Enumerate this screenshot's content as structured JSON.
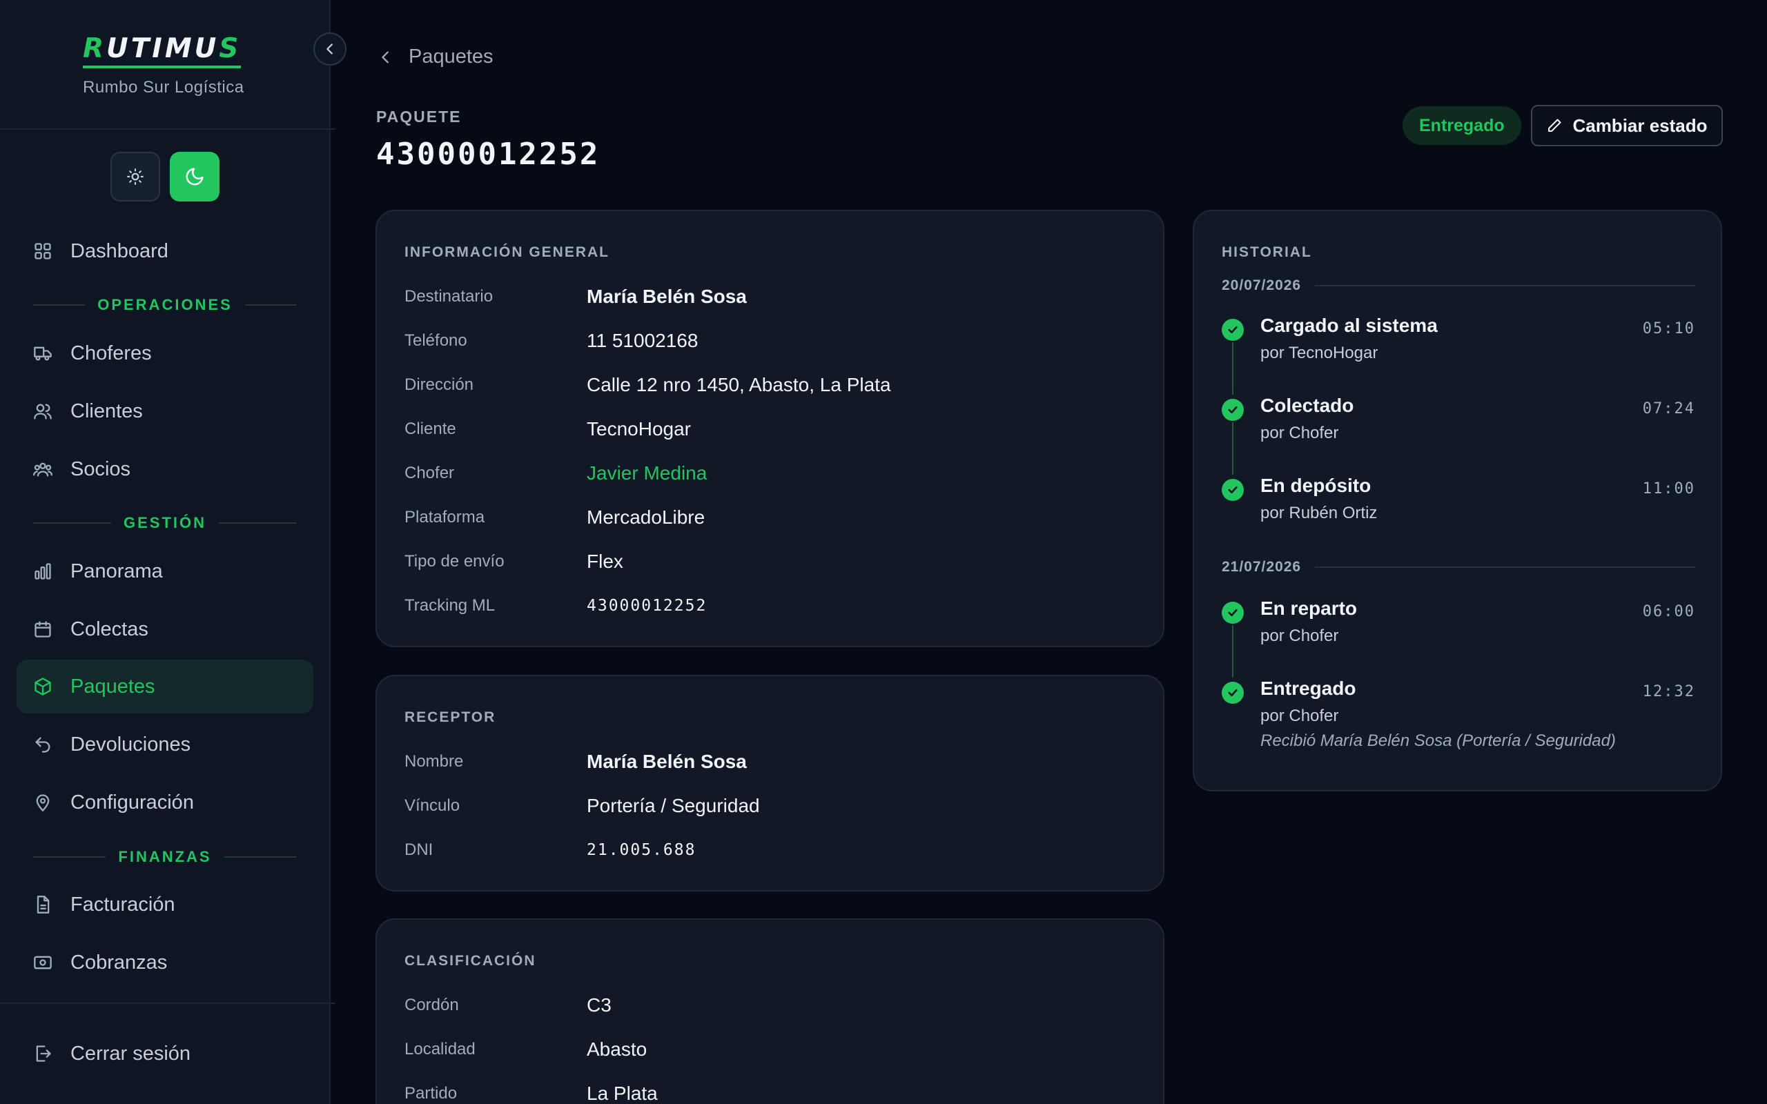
{
  "brand": {
    "logo_first": "R",
    "logo_middle": "UTIMU",
    "logo_last": "S",
    "subtitle": "Rumbo Sur Logística"
  },
  "sidebar": {
    "dashboard": "Dashboard",
    "sections": {
      "operaciones": "OPERACIONES",
      "gestion": "GESTIÓN",
      "finanzas": "FINANZAS"
    },
    "items": {
      "choferes": "Choferes",
      "clientes": "Clientes",
      "socios": "Socios",
      "panorama": "Panorama",
      "colectas": "Colectas",
      "paquetes": "Paquetes",
      "devoluciones": "Devoluciones",
      "configuracion": "Configuración",
      "facturacion": "Facturación",
      "cobranzas": "Cobranzas"
    },
    "logout": "Cerrar sesión",
    "active_item": "paquetes"
  },
  "header": {
    "back_label": "Paquetes",
    "label": "PAQUETE",
    "package_id": "43000012252",
    "status": "Entregado",
    "change_status": "Cambiar estado"
  },
  "general": {
    "title": "INFORMACIÓN GENERAL",
    "rows": [
      {
        "label": "Destinatario",
        "value": "María Belén Sosa"
      },
      {
        "label": "Teléfono",
        "value": "11 51002168"
      },
      {
        "label": "Dirección",
        "value": "Calle 12 nro 1450, Abasto, La Plata"
      },
      {
        "label": "Cliente",
        "value": "TecnoHogar"
      },
      {
        "label": "Chofer",
        "value": "Javier Medina"
      },
      {
        "label": "Plataforma",
        "value": "MercadoLibre"
      },
      {
        "label": "Tipo de envío",
        "value": "Flex"
      },
      {
        "label": "Tracking ML",
        "value": "43000012252"
      }
    ]
  },
  "receptor": {
    "title": "RECEPTOR",
    "rows": [
      {
        "label": "Nombre",
        "value": "María Belén Sosa"
      },
      {
        "label": "Vínculo",
        "value": "Portería / Seguridad"
      },
      {
        "label": "DNI",
        "value": "21.005.688"
      }
    ]
  },
  "clasificacion": {
    "title": "CLASIFICACIÓN",
    "rows": [
      {
        "label": "Cordón",
        "value": "C3"
      },
      {
        "label": "Localidad",
        "value": "Abasto"
      },
      {
        "label": "Partido",
        "value": "La Plata"
      }
    ]
  },
  "historial": {
    "title": "HISTORIAL",
    "groups": [
      {
        "date": "20/07/2026",
        "events": [
          {
            "title": "Cargado al sistema",
            "by": "por TecnoHogar",
            "time": "05:10"
          },
          {
            "title": "Colectado",
            "by": "por Chofer",
            "time": "07:24"
          },
          {
            "title": "En depósito",
            "by": "por Rubén Ortiz",
            "time": "11:00"
          }
        ]
      },
      {
        "date": "21/07/2026",
        "events": [
          {
            "title": "En reparto",
            "by": "por Chofer",
            "time": "06:00"
          },
          {
            "title": "Entregado",
            "by": "por Chofer",
            "time": "12:32",
            "note": "Recibió María Belén Sosa (Portería / Seguridad)"
          }
        ]
      }
    ]
  },
  "colors": {
    "accent": "#22c55e",
    "background": "#050a14",
    "sidebar": "#0e1623",
    "card": "#111826"
  }
}
